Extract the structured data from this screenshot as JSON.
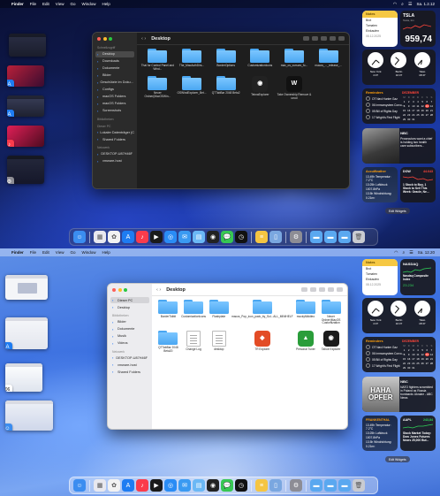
{
  "menubar_dark": {
    "app": "Finder",
    "items": [
      "File",
      "Edit",
      "View",
      "Go",
      "Window",
      "Help"
    ],
    "clock": "Sa. 1.2.12"
  },
  "menubar_light": {
    "app": "Finder",
    "items": [
      "File",
      "Edit",
      "View",
      "Go",
      "Window",
      "Help"
    ],
    "clock": "Sa. 12.20"
  },
  "finder_dark": {
    "title": "Desktop",
    "sidebar": [
      {
        "head": "Schnellzugriff"
      },
      {
        "label": "Desktop",
        "active": true
      },
      {
        "label": "Downloads"
      },
      {
        "label": "Dokumente"
      },
      {
        "label": "Bilder"
      },
      {
        "label": "Geschützte im Doku..."
      },
      {
        "label": "Configs"
      },
      {
        "label": "macOS Folders"
      },
      {
        "label": "macOS Folders"
      },
      {
        "label": "Screenshots"
      },
      {
        "head": "Bibliotheken"
      },
      {
        "head": "Dieser PC"
      },
      {
        "label": "Lokaler Datenträger (C:)"
      },
      {
        "label": "Shared Folders"
      },
      {
        "head": "Netzwerk"
      },
      {
        "label": "DESKTOP-U87H46F"
      },
      {
        "label": "vmware-host"
      }
    ],
    "items": [
      {
        "kind": "folder",
        "label": "Thai for Control Panel and Wind..."
      },
      {
        "kind": "folder",
        "label": "The_MacAuthDirs..."
      },
      {
        "kind": "folder",
        "label": "BorderOptions"
      },
      {
        "kind": "folder",
        "label": "CustomizationIcons"
      },
      {
        "kind": "folder",
        "label": "mac_os_cursors_fo..."
      },
      {
        "kind": "folder",
        "label": "macos_..._release_..."
      },
      {
        "kind": "folder",
        "label": "Neuer Ordner(MacOSWin..."
      },
      {
        "kind": "folder",
        "label": "OSWindExplorer_Bet..."
      },
      {
        "kind": "folder",
        "label": "QTTabBar 2048 Beta2"
      },
      {
        "kind": "app",
        "label": "TeknaExplorer",
        "color": "#222",
        "glyph": "◉"
      },
      {
        "kind": "app",
        "label": "Take Ownership Remove & unod",
        "color": "#111",
        "glyph": "W"
      }
    ]
  },
  "finder_light": {
    "title": "Desktop",
    "sidebar": [
      {
        "label": "Dieser PC",
        "active": true
      },
      {
        "label": "Desktop"
      },
      {
        "head": "Bibliotheken"
      },
      {
        "label": "Bilder"
      },
      {
        "label": "Dokumente"
      },
      {
        "label": "Musik"
      },
      {
        "label": "Videos"
      },
      {
        "head": "Netzwerk"
      },
      {
        "label": "DESKTOP-U87H46F"
      },
      {
        "label": "vmware-host"
      },
      {
        "label": "Shared Folders"
      }
    ],
    "items": [
      {
        "kind": "folder",
        "label": "BorderTidbit"
      },
      {
        "kind": "folder",
        "label": "CustomizationIcons"
      },
      {
        "kind": "folder",
        "label": "Flashplate"
      },
      {
        "kind": "folder",
        "label": "macos_Pop_icon_pack_by_Sol...ALL_MINIHELF"
      },
      {
        "kind": "folder",
        "label": "mockyMiddleo"
      },
      {
        "kind": "folder",
        "label": "Neuer Ordner(MacOS Customization"
      },
      {
        "kind": "folder",
        "label": "QTTabBar 2048 Beta20"
      },
      {
        "kind": "doc",
        "label": "Change Log"
      },
      {
        "kind": "doc",
        "label": "desktop"
      },
      {
        "kind": "app",
        "label": "7R Explorer",
        "color": "#e34c26",
        "glyph": "◆"
      },
      {
        "kind": "app",
        "label": "Personal Tuner",
        "color": "#2a9d3a",
        "glyph": "▲"
      },
      {
        "kind": "app",
        "label": "Tahoe Explorer",
        "color": "#1b1b1b",
        "glyph": "◉"
      }
    ]
  },
  "widgets_dark": {
    "notes": {
      "title": "Notes",
      "lines": [
        "Brot",
        "Tomaten",
        "Einkaufen"
      ],
      "date": "08.12.2025"
    },
    "stock": {
      "symbol": "TSLA",
      "name": "Tesla, Inc.",
      "price": "959,74"
    },
    "clocks": [
      {
        "city": "New York",
        "time": "4:37"
      },
      {
        "city": "Berlin",
        "time": "10:37"
      },
      {
        "city": "Tokio",
        "time": "18:37"
      }
    ],
    "reminders": {
      "title": "Reminders",
      "items": [
        "OT Navi Hunter Gaz",
        "06 Immunsystem Corvo...",
        "05 Bill of Rights Day",
        "17 Wright's First Flight"
      ]
    },
    "calendar": {
      "month": "DEZEMBER",
      "days": [
        "M",
        "D",
        "M",
        "D",
        "F",
        "S",
        "S",
        "1",
        "2",
        "3",
        "4",
        "5",
        "6",
        "7",
        "8",
        "9",
        "10",
        "11",
        "12",
        "13",
        "14",
        "15",
        "16",
        "17",
        "18",
        "19",
        "20",
        "21",
        "22",
        "23",
        "24",
        "25",
        "26",
        "27",
        "28",
        "29",
        "30",
        "31"
      ],
      "today": "13"
    },
    "news": {
      "source": "NBC",
      "headline": "Prosecutors want a chief is holding two health care subscribers..."
    },
    "weather": {
      "source": "AccuWeather",
      "lines": [
        "13.49h Temperatur: 7.2°C",
        "13:25h Luftdruck",
        "1007.8hPa",
        "13.5h Windrichtung:",
        "0.21m²"
      ]
    },
    "market": {
      "title": "DOW",
      "value": "44.643",
      "headline": "1 Stock to Buy, 1 Stock to Sell This Week: Oracle, Ne..."
    },
    "edit": "Edit Widgets"
  },
  "widgets_light": {
    "notes": {
      "title": "Notes",
      "lines": [
        "Brot",
        "Tomaten",
        "Einkaufen"
      ],
      "date": "08.12.2025"
    },
    "stock": {
      "symbol": "NASDAQ",
      "name": "Nasdaq Composite Index",
      "price": "23.234"
    },
    "clocks": [
      {
        "city": "New York",
        "time": "4:37"
      },
      {
        "city": "Berlin",
        "time": "10:37"
      },
      {
        "city": "Tokio",
        "time": "18:37"
      }
    ],
    "reminders": {
      "title": "Reminders",
      "items": [
        "OT Navi Hunter Gaz",
        "06 Immunsystem Corvo...",
        "05 Bill of Rights Day",
        "17 Wright's First Flight"
      ]
    },
    "calendar": {
      "month": "DEZEMBER",
      "days": [
        "M",
        "D",
        "M",
        "D",
        "F",
        "S",
        "S",
        "1",
        "2",
        "3",
        "4",
        "5",
        "6",
        "7",
        "8",
        "9",
        "10",
        "11",
        "12",
        "13",
        "14",
        "15",
        "16",
        "17",
        "18",
        "19",
        "20",
        "21",
        "22",
        "23",
        "24",
        "25",
        "26",
        "27",
        "28",
        "29",
        "30",
        "31"
      ],
      "today": "13"
    },
    "news": {
      "source": "NBC",
      "headline": "NATO fighters scrambled in Poland as Russia bombards Ukraine - ABC News",
      "image_text": "HAHA OPFER"
    },
    "weather": {
      "source": "FRANKENTHAL",
      "lines": [
        "13.49h Temperatur: 7.2°C",
        "13:25h Luftdruck",
        "1007.8hPa",
        "13.5h Windrichtung:",
        "0.21m²"
      ]
    },
    "market": {
      "title": "AAPL",
      "value": "243,84",
      "headline": "Stock Market Today: Dow Jones Futures Nears 25,000 But..."
    },
    "edit": "Edit Widgets"
  },
  "dock_icons": [
    {
      "name": "finder-icon",
      "color": "#3b8df0",
      "glyph": "☺"
    },
    {
      "sep": true
    },
    {
      "name": "launchpad-icon",
      "color": "#e8e8ef",
      "glyph": "▦"
    },
    {
      "name": "photos-icon",
      "color": "#f2f2f2",
      "glyph": "✿"
    },
    {
      "name": "app-store-icon",
      "color": "#1e7cf2",
      "glyph": "A"
    },
    {
      "name": "music-icon",
      "color": "#fa3c4c",
      "glyph": "♪"
    },
    {
      "name": "tv-icon",
      "color": "#1a1a1a",
      "glyph": "▶"
    },
    {
      "name": "safari-icon",
      "color": "#2a8cf5",
      "glyph": "◎"
    },
    {
      "name": "mail-icon",
      "color": "#3a9af2",
      "glyph": "✉"
    },
    {
      "name": "preview-icon",
      "color": "#6bb8f5",
      "glyph": "▤"
    },
    {
      "name": "photo-booth-icon",
      "color": "#222",
      "glyph": "◉"
    },
    {
      "name": "messages-icon",
      "color": "#37c753",
      "glyph": "💬"
    },
    {
      "name": "clock-icon",
      "color": "#111",
      "glyph": "◷"
    },
    {
      "sep": true
    },
    {
      "name": "notes-icon",
      "color": "#f5c542",
      "glyph": "≡"
    },
    {
      "name": "files-icon",
      "color": "#7aa7e0",
      "glyph": "▯"
    },
    {
      "sep": true
    },
    {
      "name": "settings-icon",
      "color": "#8d8d95",
      "glyph": "⚙"
    },
    {
      "sep": true
    },
    {
      "name": "folder-icon",
      "color": "#5aa8f0",
      "glyph": "▬"
    },
    {
      "name": "folder-icon-2",
      "color": "#5aa8f0",
      "glyph": "▬"
    },
    {
      "name": "folder-icon-3",
      "color": "#5aa8f0",
      "glyph": "▬"
    },
    {
      "name": "trash-icon",
      "color": "#c9cbd1",
      "glyph": "🗑"
    }
  ]
}
